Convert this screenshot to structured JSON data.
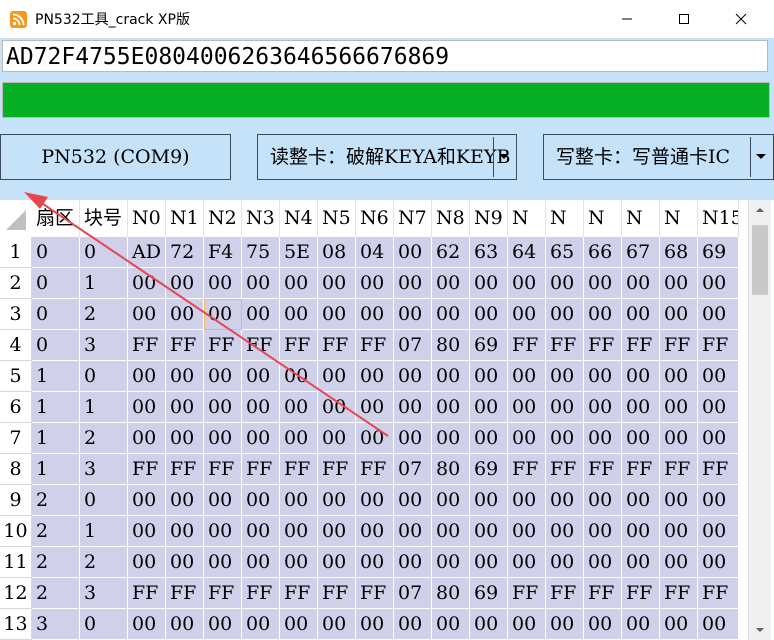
{
  "window": {
    "title": "PN532工具_crack XP版"
  },
  "uid_field": {
    "value": "AD72F4755E0804006263646566676869"
  },
  "progress": {
    "fraction": 1.0,
    "color": "#06b025"
  },
  "buttons": {
    "pn532_label": "PN532 (COM9)",
    "read_combo_value": "读整卡：破解KEYA和KEYB",
    "write_combo_value": "写整卡：写普通卡IC"
  },
  "table": {
    "columns": [
      "扇区",
      "块号",
      "N0",
      "N1",
      "N2",
      "N3",
      "N4",
      "N5",
      "N6",
      "N7",
      "N8",
      "N9",
      "N",
      "N",
      "N",
      "N",
      "N",
      "N15"
    ],
    "rows": [
      {
        "n": "1",
        "cells": [
          "0",
          "0",
          "AD",
          "72",
          "F4",
          "75",
          "5E",
          "08",
          "04",
          "00",
          "62",
          "63",
          "64",
          "65",
          "66",
          "67",
          "68",
          "69"
        ]
      },
      {
        "n": "2",
        "cells": [
          "0",
          "1",
          "00",
          "00",
          "00",
          "00",
          "00",
          "00",
          "00",
          "00",
          "00",
          "00",
          "00",
          "00",
          "00",
          "00",
          "00",
          "00"
        ]
      },
      {
        "n": "3",
        "cells": [
          "0",
          "2",
          "00",
          "00",
          "00",
          "00",
          "00",
          "00",
          "00",
          "00",
          "00",
          "00",
          "00",
          "00",
          "00",
          "00",
          "00",
          "00"
        ]
      },
      {
        "n": "4",
        "cells": [
          "0",
          "3",
          "FF",
          "FF",
          "FF",
          "FF",
          "FF",
          "FF",
          "FF",
          "07",
          "80",
          "69",
          "FF",
          "FF",
          "FF",
          "FF",
          "FF",
          "FF"
        ]
      },
      {
        "n": "5",
        "cells": [
          "1",
          "0",
          "00",
          "00",
          "00",
          "00",
          "00",
          "00",
          "00",
          "00",
          "00",
          "00",
          "00",
          "00",
          "00",
          "00",
          "00",
          "00"
        ]
      },
      {
        "n": "6",
        "cells": [
          "1",
          "1",
          "00",
          "00",
          "00",
          "00",
          "00",
          "00",
          "00",
          "00",
          "00",
          "00",
          "00",
          "00",
          "00",
          "00",
          "00",
          "00"
        ]
      },
      {
        "n": "7",
        "cells": [
          "1",
          "2",
          "00",
          "00",
          "00",
          "00",
          "00",
          "00",
          "00",
          "00",
          "00",
          "00",
          "00",
          "00",
          "00",
          "00",
          "00",
          "00"
        ]
      },
      {
        "n": "8",
        "cells": [
          "1",
          "3",
          "FF",
          "FF",
          "FF",
          "FF",
          "FF",
          "FF",
          "FF",
          "07",
          "80",
          "69",
          "FF",
          "FF",
          "FF",
          "FF",
          "FF",
          "FF"
        ]
      },
      {
        "n": "9",
        "cells": [
          "2",
          "0",
          "00",
          "00",
          "00",
          "00",
          "00",
          "00",
          "00",
          "00",
          "00",
          "00",
          "00",
          "00",
          "00",
          "00",
          "00",
          "00"
        ]
      },
      {
        "n": "10",
        "cells": [
          "2",
          "1",
          "00",
          "00",
          "00",
          "00",
          "00",
          "00",
          "00",
          "00",
          "00",
          "00",
          "00",
          "00",
          "00",
          "00",
          "00",
          "00"
        ]
      },
      {
        "n": "11",
        "cells": [
          "2",
          "2",
          "00",
          "00",
          "00",
          "00",
          "00",
          "00",
          "00",
          "00",
          "00",
          "00",
          "00",
          "00",
          "00",
          "00",
          "00",
          "00"
        ]
      },
      {
        "n": "12",
        "cells": [
          "2",
          "3",
          "FF",
          "FF",
          "FF",
          "FF",
          "FF",
          "FF",
          "FF",
          "07",
          "80",
          "69",
          "FF",
          "FF",
          "FF",
          "FF",
          "FF",
          "FF"
        ]
      },
      {
        "n": "13",
        "cells": [
          "3",
          "0",
          "00",
          "00",
          "00",
          "00",
          "00",
          "00",
          "00",
          "00",
          "00",
          "00",
          "00",
          "00",
          "00",
          "00",
          "00",
          "00"
        ]
      }
    ]
  },
  "icons": {
    "app": "rss-feed-icon",
    "minimize": "minimize-icon",
    "maximize": "maximize-icon",
    "close": "close-icon",
    "combo_arrow": "chevron-down-icon"
  },
  "annotation_color": "#e8464e"
}
